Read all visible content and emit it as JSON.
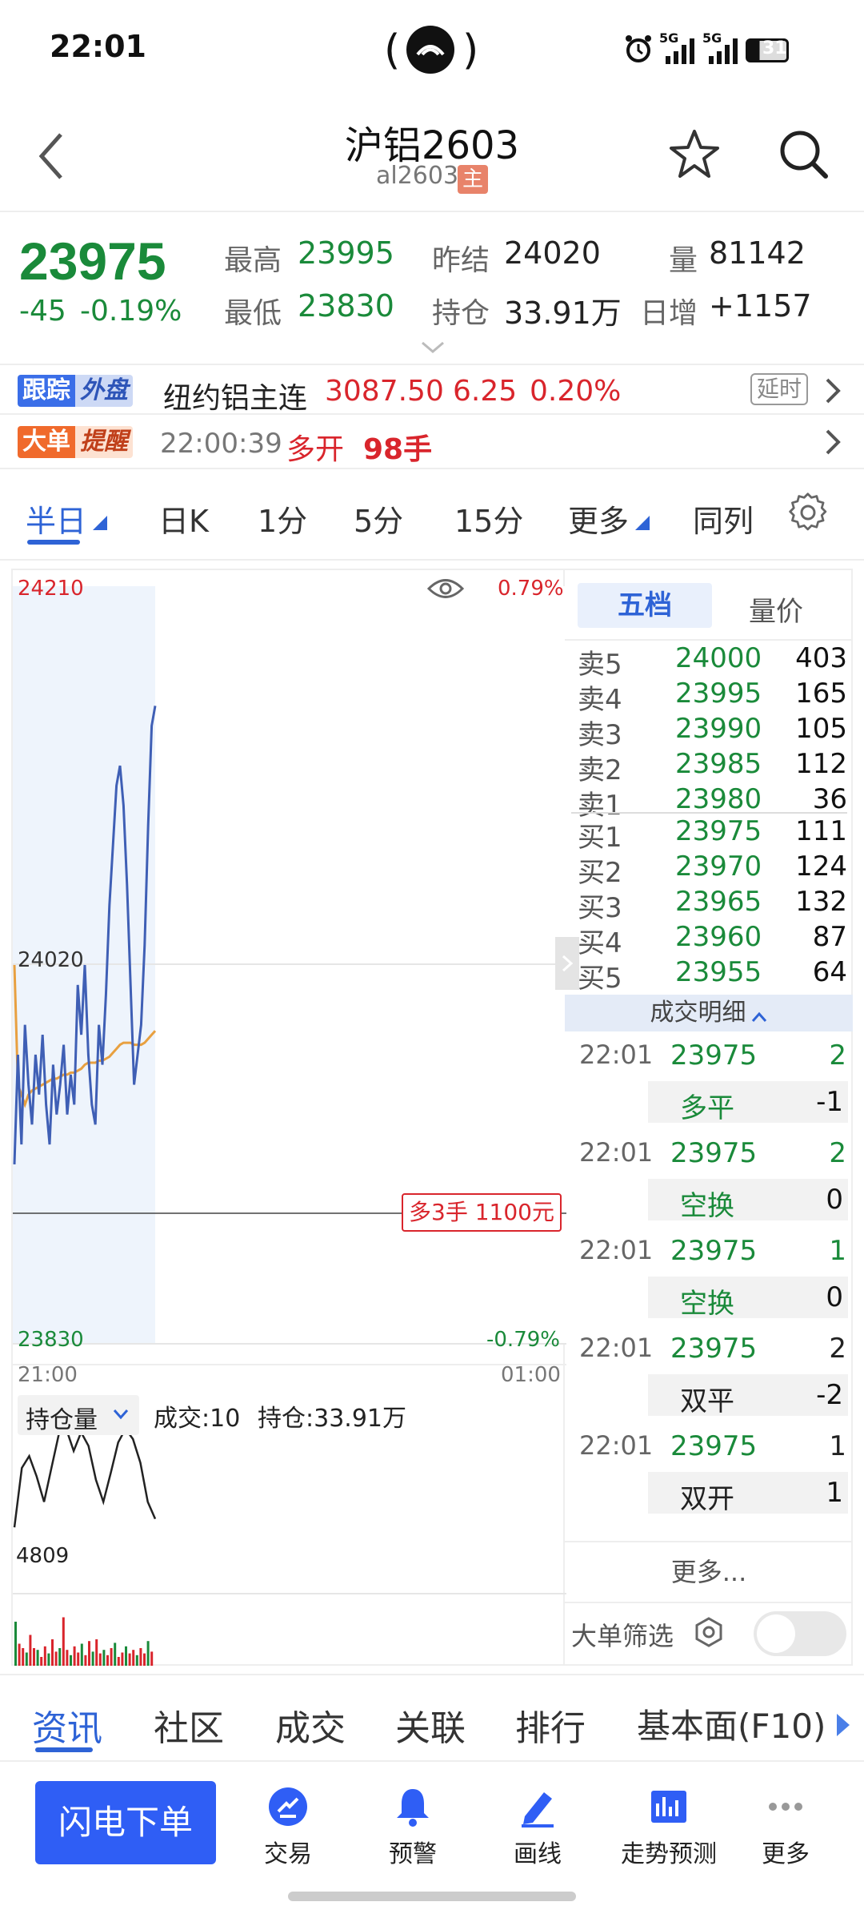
{
  "status": {
    "time": "22:01",
    "signal1": "5G",
    "signal2": "5G",
    "battery": "31"
  },
  "header": {
    "title": "沪铝2603",
    "code": "al2603",
    "badge": "主"
  },
  "quote": {
    "price": "23975",
    "change": "-45",
    "change_pct": "-0.19%",
    "high_label": "最高",
    "high": "23995",
    "low_label": "最低",
    "low": "23830",
    "prev_settle_label": "昨结",
    "prev_settle": "24020",
    "oi_label": "持仓",
    "oi": "33.91万",
    "vol_label": "量",
    "vol": "81142",
    "daily_inc_label": "日增",
    "daily_inc": "+1157"
  },
  "external": {
    "tag_a": "跟踪",
    "tag_b": "外盘",
    "name": "纽约铝主连",
    "price": "3087.50",
    "change": "6.25",
    "pct": "0.20%",
    "delay": "延时"
  },
  "alert": {
    "tag_a": "大单",
    "tag_b": "提醒",
    "time": "22:00:39",
    "action": "多开",
    "qty": "98手"
  },
  "periods": [
    "半日",
    "日K",
    "1分",
    "5分",
    "15分",
    "更多",
    "同列"
  ],
  "chart_data": {
    "type": "line",
    "y_top": "24210",
    "y_mid": "24020",
    "y_bottom": "23830",
    "pct_top": "0.79%",
    "pct_bottom": "-0.79%",
    "x_start": "21:00",
    "x_end": "01:00",
    "ylim": [
      23830,
      24210
    ],
    "marker_label": "多3手  1100元",
    "price_series": [
      23920,
      23975,
      23930,
      23990,
      23960,
      23940,
      23975,
      23955,
      23985,
      23950,
      23930,
      23970,
      23945,
      23960,
      23980,
      23945,
      23965,
      23950,
      24010,
      23985,
      24020,
      23975,
      23950,
      23940,
      23990,
      23970,
      24005,
      24050,
      24080,
      24110,
      24120,
      24100,
      24060,
      24010,
      23960,
      23975,
      23990,
      24030,
      24090,
      24140,
      24150
    ],
    "avg_series": [
      24020,
      23960,
      23955,
      23950,
      23955,
      23957,
      23958,
      23959,
      23960,
      23961,
      23962,
      23963,
      23963,
      23964,
      23965,
      23965,
      23966,
      23966,
      23967,
      23968,
      23970,
      23971,
      23971,
      23971,
      23972,
      23972,
      23973,
      23974,
      23976,
      23978,
      23980,
      23981,
      23981,
      23981,
      23980,
      23980,
      23980,
      23981,
      23983,
      23985,
      23987
    ]
  },
  "oi_panel": {
    "selector": "持仓量",
    "vol_text": "成交:10",
    "oi_text": "持仓:33.91万",
    "level": "4809"
  },
  "orderbook": {
    "tabs": [
      "五档",
      "量价"
    ],
    "asks": [
      {
        "label": "卖5",
        "price": "24000",
        "vol": "403"
      },
      {
        "label": "卖4",
        "price": "23995",
        "vol": "165"
      },
      {
        "label": "卖3",
        "price": "23990",
        "vol": "105"
      },
      {
        "label": "卖2",
        "price": "23985",
        "vol": "112"
      },
      {
        "label": "卖1",
        "price": "23980",
        "vol": "36"
      }
    ],
    "bids": [
      {
        "label": "买1",
        "price": "23975",
        "vol": "111"
      },
      {
        "label": "买2",
        "price": "23970",
        "vol": "124"
      },
      {
        "label": "买3",
        "price": "23965",
        "vol": "132"
      },
      {
        "label": "买4",
        "price": "23960",
        "vol": "87"
      },
      {
        "label": "买5",
        "price": "23955",
        "vol": "64"
      }
    ],
    "detail_title": "成交明细",
    "trades": [
      {
        "time": "22:01",
        "price": "23975",
        "vol": "2",
        "kind": "多平",
        "net": "-1"
      },
      {
        "time": "22:01",
        "price": "23975",
        "vol": "2",
        "kind": "空换",
        "net": "0"
      },
      {
        "time": "22:01",
        "price": "23975",
        "vol": "1",
        "kind": "空换",
        "net": "0"
      },
      {
        "time": "22:01",
        "price": "23975",
        "vol": "2",
        "kind": "双平",
        "net": "-2"
      },
      {
        "time": "22:01",
        "price": "23975",
        "vol": "1",
        "kind": "双开",
        "net": "1"
      }
    ],
    "more": "更多...",
    "big_filter": "大单筛选"
  },
  "info_tabs": [
    "资讯",
    "社区",
    "成交",
    "关联",
    "排行",
    "基本面(F10)"
  ],
  "bottom": {
    "flash": "闪电下单",
    "items": [
      "交易",
      "预警",
      "画线",
      "走势预测",
      "更多"
    ]
  },
  "colors": {
    "up": "#d9252c",
    "down": "#1a8a3a",
    "accent": "#2e63d6",
    "price_line": "#3f5fb5",
    "avg_line": "#e8a040"
  }
}
